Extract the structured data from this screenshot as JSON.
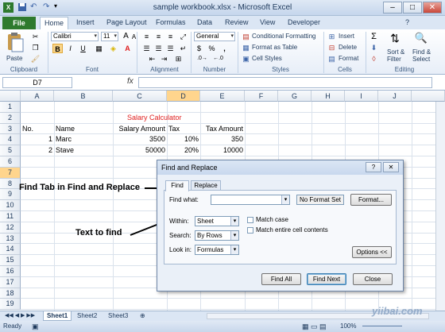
{
  "window": {
    "title": "sample workbook.xlsx  -  Microsoft Excel",
    "min_glyph": "–",
    "max_glyph": "□",
    "close_glyph": "✕"
  },
  "ribbon": {
    "file_tab": "File",
    "tabs": [
      "Home",
      "Insert",
      "Page Layout",
      "Formulas",
      "Data",
      "Review",
      "View",
      "Developer"
    ],
    "clipboard": {
      "paste": "Paste",
      "label": "Clipboard"
    },
    "font": {
      "name": "Calibri",
      "size": "11",
      "label": "Font"
    },
    "alignment": {
      "label": "Alignment"
    },
    "number": {
      "format": "General",
      "currency": "$",
      "percent": "%",
      "comma": ",",
      "label": "Number"
    },
    "styles": {
      "conditional": "Conditional Formatting",
      "format_table": "Format as Table",
      "cell_styles": "Cell Styles",
      "label": "Styles"
    },
    "cells": {
      "insert": "Insert",
      "delete": "Delete",
      "format": "Format",
      "label": "Cells"
    },
    "editing": {
      "sort_filter_1": "Sort &",
      "sort_filter_2": "Filter",
      "find_select_1": "Find &",
      "find_select_2": "Select",
      "label": "Editing"
    }
  },
  "formula_bar": {
    "name_box": "D7",
    "fx": "fx",
    "value": ""
  },
  "grid": {
    "columns": [
      "A",
      "B",
      "C",
      "D",
      "E",
      "F",
      "G",
      "H",
      "I",
      "J"
    ],
    "selected_column": "D",
    "rows": [
      "1",
      "2",
      "3",
      "4",
      "5",
      "6",
      "7",
      "8",
      "9",
      "10",
      "11",
      "12",
      "13",
      "14",
      "15",
      "16",
      "17",
      "18",
      "19"
    ],
    "selected_row": "7",
    "title": "Salary Calculator",
    "headers": {
      "no": "No.",
      "name": "Name",
      "salary": "Salary Amount",
      "tax": "Tax",
      "tax_amount": "Tax Amount"
    },
    "data": [
      {
        "no": "1",
        "name": "Marc",
        "salary": "3500",
        "tax": "10%",
        "tax_amount": "350"
      },
      {
        "no": "2",
        "name": "Stave",
        "salary": "50000",
        "tax": "20%",
        "tax_amount": "10000"
      }
    ]
  },
  "sheets": [
    "Sheet1",
    "Sheet2",
    "Sheet3"
  ],
  "status": {
    "ready": "Ready",
    "zoom": "100%"
  },
  "dialog": {
    "title": "Find and Replace",
    "help": "?",
    "close": "✕",
    "tabs": {
      "find": "Find",
      "replace": "Replace"
    },
    "find_what_label": "Find what:",
    "find_what_value": "",
    "no_format": "No Format Set",
    "format_button": "Format...",
    "within_label": "Within:",
    "within_value": "Sheet",
    "search_label": "Search:",
    "search_value": "By Rows",
    "look_in_label": "Look in:",
    "look_in_value": "Formulas",
    "match_case": "Match case",
    "match_entire": "Match entire cell contents",
    "options_button": "Options <<",
    "find_all": "Find All",
    "find_next": "Find Next",
    "close_button": "Close"
  },
  "annotations": {
    "find_tab": "Find Tab in Find and Replace",
    "text_to_find": "Text to find"
  },
  "watermark": "yiibai.com",
  "colors": {
    "title_red": "#e02020",
    "accent_green": "#2e7a2e",
    "selection_gold": "#ffd58d"
  }
}
